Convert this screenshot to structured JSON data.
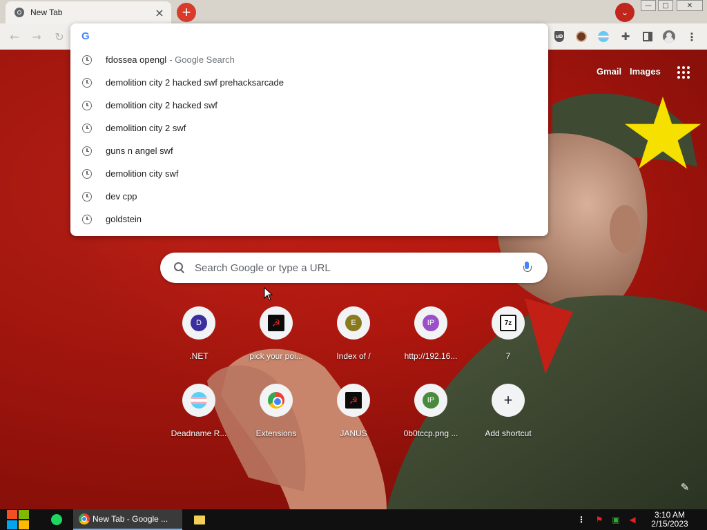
{
  "browser": {
    "tab": {
      "title": "New Tab",
      "close": "×",
      "favicon": "chrome-icon"
    },
    "new_tab_symbol": "+",
    "profile_dropdown_symbol": "⌄",
    "window_controls": {
      "minimize": "—",
      "maximize": "□",
      "close": "✕"
    },
    "nav": {
      "back": "←",
      "forward": "→",
      "reload": "↻"
    },
    "extensions": [
      "ublock-icon",
      "avatar-face-icon",
      "trans-flag-icon",
      "puzzle-icon",
      "sidepanel-icon",
      "profile-icon",
      "menu-kebab-icon"
    ],
    "ublock_label": "uD",
    "menu_symbol": "⋮",
    "puzzle_symbol": "✚"
  },
  "omnibox": {
    "input_value": "",
    "suggestions": [
      {
        "text": "fdossea opengl",
        "suffix": "- Google Search"
      },
      {
        "text": "demolition city 2 hacked swf prehacksarcade",
        "suffix": ""
      },
      {
        "text": "demolition city 2 hacked swf",
        "suffix": ""
      },
      {
        "text": "demolition city 2 swf",
        "suffix": ""
      },
      {
        "text": "guns n angel swf",
        "suffix": ""
      },
      {
        "text": "demolition city swf",
        "suffix": ""
      },
      {
        "text": "dev cpp",
        "suffix": ""
      },
      {
        "text": "goldstein",
        "suffix": ""
      }
    ],
    "g_logo": "G"
  },
  "ntp": {
    "gmail": "Gmail",
    "images": "Images",
    "search_placeholder": "Search Google or type a URL",
    "shortcuts": [
      {
        "label": ".NET",
        "icon_text": "D",
        "icon_color": "#3b2f9e",
        "icon_kind": "letter"
      },
      {
        "label": "pick your poi...",
        "icon_text": "☭",
        "icon_color": "#0b0b0b",
        "icon_kind": "square"
      },
      {
        "label": "Index of /",
        "icon_text": "E",
        "icon_color": "#8a7a1e",
        "icon_kind": "letter"
      },
      {
        "label": "http://192.16...",
        "icon_text": "IP",
        "icon_color": "#9b4fc9",
        "icon_kind": "letter"
      },
      {
        "label": "7",
        "icon_text": "7z",
        "icon_color": "#ffffff",
        "icon_kind": "7z"
      },
      {
        "label": "Deadname R...",
        "icon_text": "",
        "icon_color": "#5bcffa",
        "icon_kind": "trans"
      },
      {
        "label": "Extensions",
        "icon_text": "",
        "icon_color": "#4285f4",
        "icon_kind": "chrome"
      },
      {
        "label": "JANUS",
        "icon_text": "☭",
        "icon_color": "#0b0b0b",
        "icon_kind": "square"
      },
      {
        "label": "0b0tccp.png ...",
        "icon_text": "IP",
        "icon_color": "#4a8a3c",
        "icon_kind": "letter"
      },
      {
        "label": "Add shortcut",
        "icon_text": "+",
        "icon_color": "#202124",
        "icon_kind": "plus"
      }
    ],
    "customize_symbol": "✎"
  },
  "taskbar": {
    "chrome_label": "New Tab - Google ...",
    "tray": {
      "more": "⋮",
      "flag": "⚑",
      "net": "▣",
      "vol": "◀"
    },
    "time": "3:10 AM",
    "date": "2/15/2023"
  },
  "colors": {
    "accent_red": "#d93b2b",
    "ntp_red": "#c41e14",
    "star_yellow": "#f6e000"
  }
}
